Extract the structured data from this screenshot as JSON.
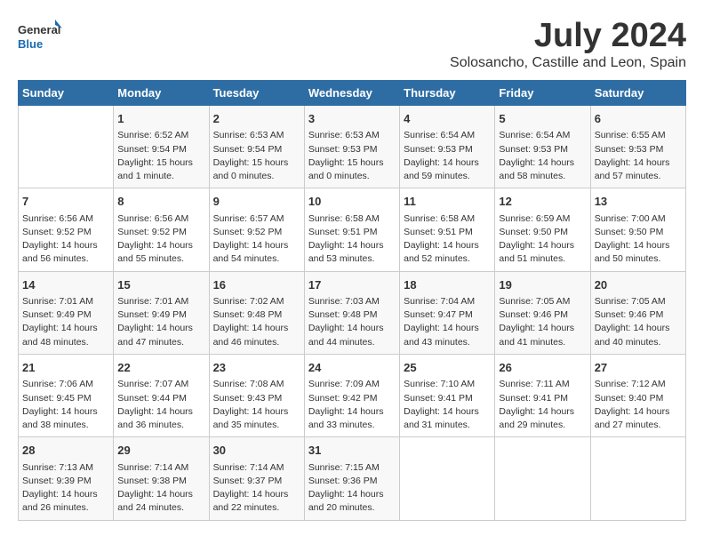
{
  "logo": {
    "text_general": "General",
    "text_blue": "Blue"
  },
  "title": {
    "month_year": "July 2024",
    "location": "Solosancho, Castille and Leon, Spain"
  },
  "days_of_week": [
    "Sunday",
    "Monday",
    "Tuesday",
    "Wednesday",
    "Thursday",
    "Friday",
    "Saturday"
  ],
  "weeks": [
    [
      {
        "day": "",
        "content": ""
      },
      {
        "day": "1",
        "content": "Sunrise: 6:52 AM\nSunset: 9:54 PM\nDaylight: 15 hours\nand 1 minute."
      },
      {
        "day": "2",
        "content": "Sunrise: 6:53 AM\nSunset: 9:54 PM\nDaylight: 15 hours\nand 0 minutes."
      },
      {
        "day": "3",
        "content": "Sunrise: 6:53 AM\nSunset: 9:53 PM\nDaylight: 15 hours\nand 0 minutes."
      },
      {
        "day": "4",
        "content": "Sunrise: 6:54 AM\nSunset: 9:53 PM\nDaylight: 14 hours\nand 59 minutes."
      },
      {
        "day": "5",
        "content": "Sunrise: 6:54 AM\nSunset: 9:53 PM\nDaylight: 14 hours\nand 58 minutes."
      },
      {
        "day": "6",
        "content": "Sunrise: 6:55 AM\nSunset: 9:53 PM\nDaylight: 14 hours\nand 57 minutes."
      }
    ],
    [
      {
        "day": "7",
        "content": "Sunrise: 6:56 AM\nSunset: 9:52 PM\nDaylight: 14 hours\nand 56 minutes."
      },
      {
        "day": "8",
        "content": "Sunrise: 6:56 AM\nSunset: 9:52 PM\nDaylight: 14 hours\nand 55 minutes."
      },
      {
        "day": "9",
        "content": "Sunrise: 6:57 AM\nSunset: 9:52 PM\nDaylight: 14 hours\nand 54 minutes."
      },
      {
        "day": "10",
        "content": "Sunrise: 6:58 AM\nSunset: 9:51 PM\nDaylight: 14 hours\nand 53 minutes."
      },
      {
        "day": "11",
        "content": "Sunrise: 6:58 AM\nSunset: 9:51 PM\nDaylight: 14 hours\nand 52 minutes."
      },
      {
        "day": "12",
        "content": "Sunrise: 6:59 AM\nSunset: 9:50 PM\nDaylight: 14 hours\nand 51 minutes."
      },
      {
        "day": "13",
        "content": "Sunrise: 7:00 AM\nSunset: 9:50 PM\nDaylight: 14 hours\nand 50 minutes."
      }
    ],
    [
      {
        "day": "14",
        "content": "Sunrise: 7:01 AM\nSunset: 9:49 PM\nDaylight: 14 hours\nand 48 minutes."
      },
      {
        "day": "15",
        "content": "Sunrise: 7:01 AM\nSunset: 9:49 PM\nDaylight: 14 hours\nand 47 minutes."
      },
      {
        "day": "16",
        "content": "Sunrise: 7:02 AM\nSunset: 9:48 PM\nDaylight: 14 hours\nand 46 minutes."
      },
      {
        "day": "17",
        "content": "Sunrise: 7:03 AM\nSunset: 9:48 PM\nDaylight: 14 hours\nand 44 minutes."
      },
      {
        "day": "18",
        "content": "Sunrise: 7:04 AM\nSunset: 9:47 PM\nDaylight: 14 hours\nand 43 minutes."
      },
      {
        "day": "19",
        "content": "Sunrise: 7:05 AM\nSunset: 9:46 PM\nDaylight: 14 hours\nand 41 minutes."
      },
      {
        "day": "20",
        "content": "Sunrise: 7:05 AM\nSunset: 9:46 PM\nDaylight: 14 hours\nand 40 minutes."
      }
    ],
    [
      {
        "day": "21",
        "content": "Sunrise: 7:06 AM\nSunset: 9:45 PM\nDaylight: 14 hours\nand 38 minutes."
      },
      {
        "day": "22",
        "content": "Sunrise: 7:07 AM\nSunset: 9:44 PM\nDaylight: 14 hours\nand 36 minutes."
      },
      {
        "day": "23",
        "content": "Sunrise: 7:08 AM\nSunset: 9:43 PM\nDaylight: 14 hours\nand 35 minutes."
      },
      {
        "day": "24",
        "content": "Sunrise: 7:09 AM\nSunset: 9:42 PM\nDaylight: 14 hours\nand 33 minutes."
      },
      {
        "day": "25",
        "content": "Sunrise: 7:10 AM\nSunset: 9:41 PM\nDaylight: 14 hours\nand 31 minutes."
      },
      {
        "day": "26",
        "content": "Sunrise: 7:11 AM\nSunset: 9:41 PM\nDaylight: 14 hours\nand 29 minutes."
      },
      {
        "day": "27",
        "content": "Sunrise: 7:12 AM\nSunset: 9:40 PM\nDaylight: 14 hours\nand 27 minutes."
      }
    ],
    [
      {
        "day": "28",
        "content": "Sunrise: 7:13 AM\nSunset: 9:39 PM\nDaylight: 14 hours\nand 26 minutes."
      },
      {
        "day": "29",
        "content": "Sunrise: 7:14 AM\nSunset: 9:38 PM\nDaylight: 14 hours\nand 24 minutes."
      },
      {
        "day": "30",
        "content": "Sunrise: 7:14 AM\nSunset: 9:37 PM\nDaylight: 14 hours\nand 22 minutes."
      },
      {
        "day": "31",
        "content": "Sunrise: 7:15 AM\nSunset: 9:36 PM\nDaylight: 14 hours\nand 20 minutes."
      },
      {
        "day": "",
        "content": ""
      },
      {
        "day": "",
        "content": ""
      },
      {
        "day": "",
        "content": ""
      }
    ]
  ]
}
